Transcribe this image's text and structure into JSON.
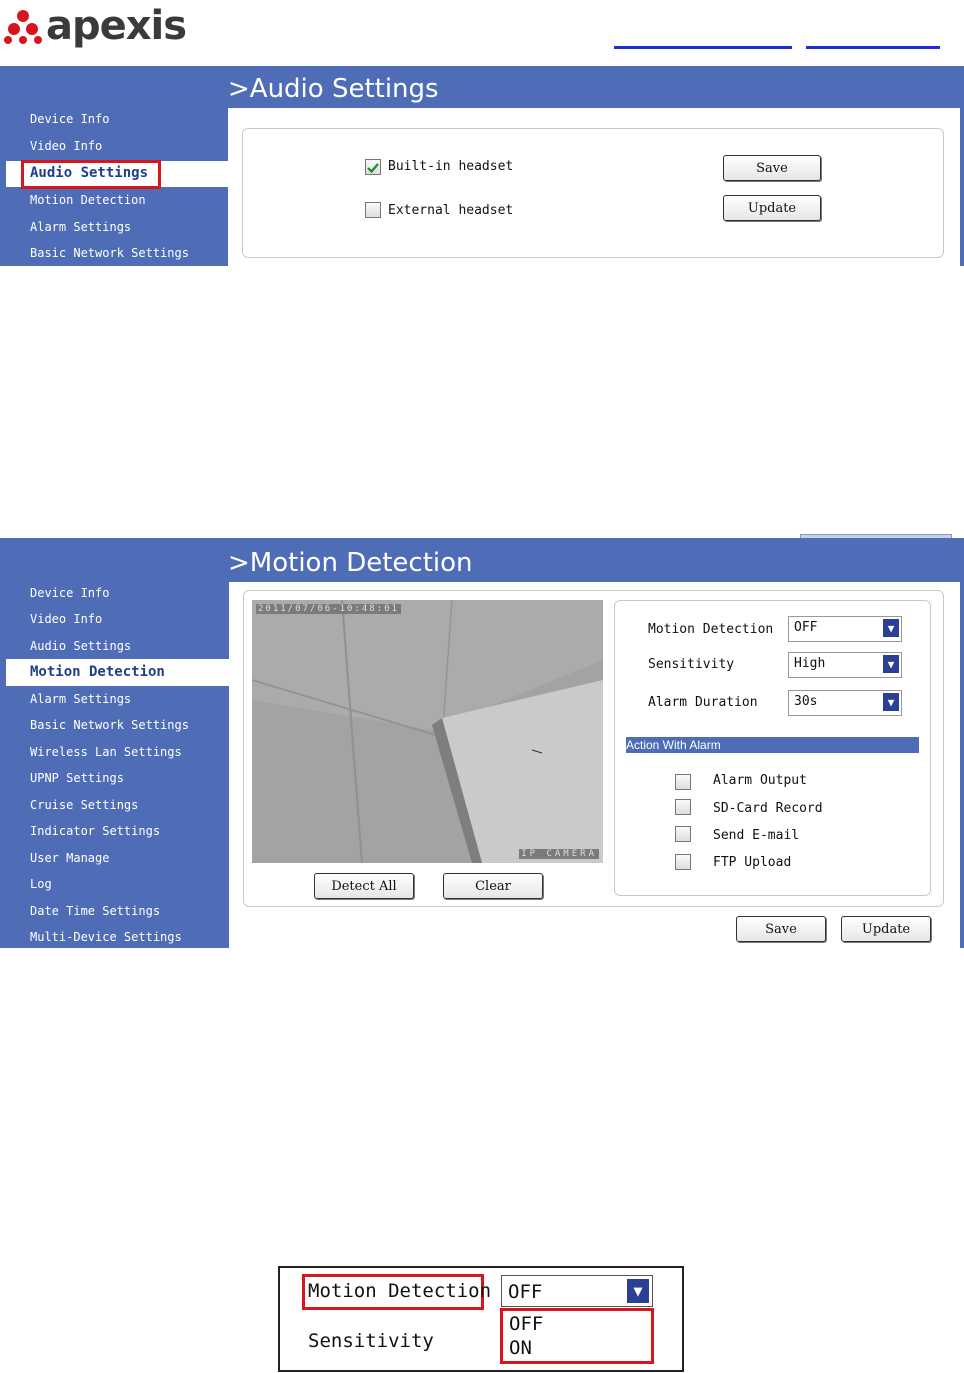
{
  "logo": {
    "text": "apexis"
  },
  "audio": {
    "title": ">Audio Settings",
    "sidebar": [
      "Device Info",
      "Video Info",
      "Audio Settings",
      "Motion Detection",
      "Alarm Settings",
      "Basic Network Settings"
    ],
    "builtin_label": "Built-in headset",
    "external_label": "External headset",
    "save_label": "Save",
    "update_label": "Update"
  },
  "motion": {
    "title": ">Motion Detection",
    "sidebar": [
      "Device Info",
      "Video Info",
      "Audio Settings",
      "Motion Detection",
      "Alarm Settings",
      "Basic Network Settings",
      "Wireless Lan Settings",
      "UPNP Settings",
      "Cruise Settings",
      "Indicator Settings",
      "User Manage",
      "Log",
      "Date Time Settings",
      "Multi-Device Settings"
    ],
    "camera_timestamp": "2011/07/06-10:48:01",
    "camera_tag": "IP CAMERA",
    "detect_all_label": "Detect All",
    "clear_label": "Clear",
    "motion_detection_label": "Motion Detection",
    "motion_detection_value": "OFF",
    "sensitivity_label": "Sensitivity",
    "sensitivity_value": "High",
    "alarm_duration_label": "Alarm Duration",
    "alarm_duration_value": "30s",
    "action_header": "Action With Alarm",
    "actions": [
      "Alarm Output",
      "SD-Card Record",
      "Send E-mail",
      "FTP Upload"
    ],
    "save_label": "Save",
    "update_label": "Update"
  },
  "zoom": {
    "motion_detection_label": "Motion Detection",
    "select_value": "OFF",
    "sensitivity_label": "Sensitivity",
    "options": [
      "OFF",
      "ON"
    ]
  },
  "colors": {
    "nav": "#4f6db6",
    "accent_red": "#d8141c",
    "active_text": "#203e8c"
  }
}
